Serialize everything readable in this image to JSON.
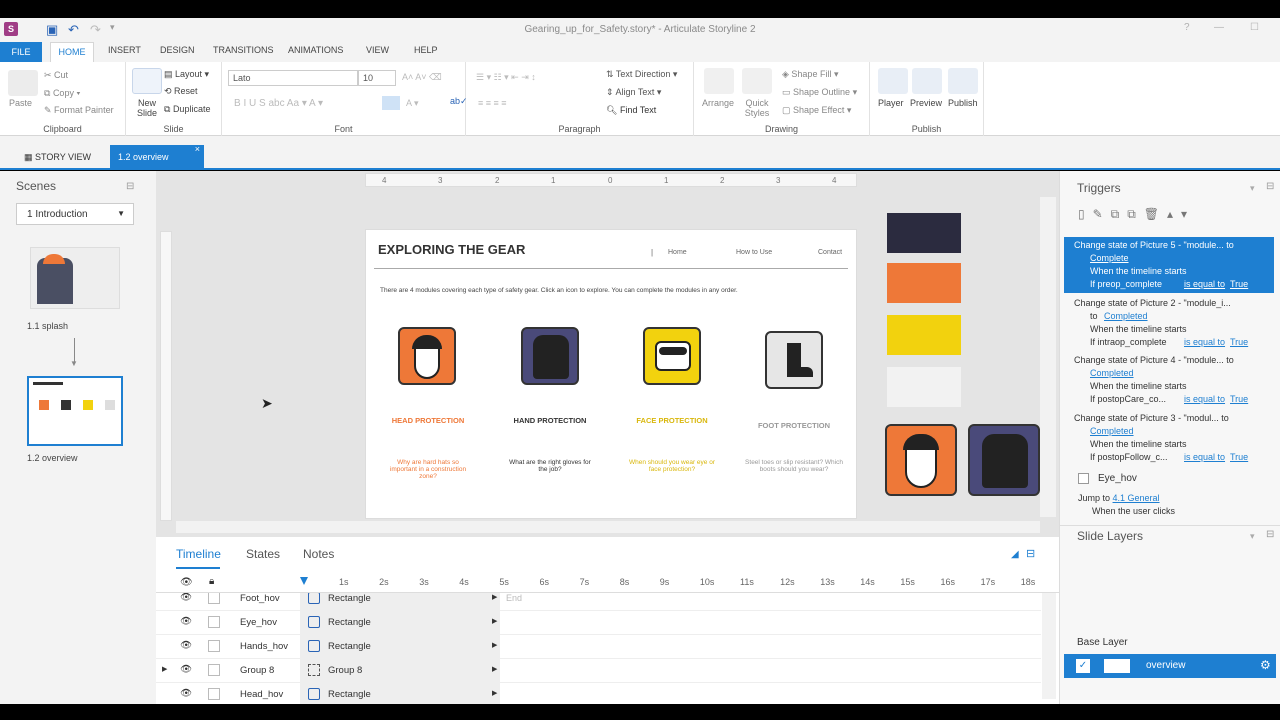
{
  "window": {
    "title": "Gearing_up_for_Safety.story* - Articulate Storyline 2",
    "app_icon": "S"
  },
  "ribbon_tabs": [
    "FILE",
    "HOME",
    "INSERT",
    "DESIGN",
    "TRANSITIONS",
    "ANIMATIONS",
    "VIEW",
    "HELP"
  ],
  "ribbon": {
    "clipboard": {
      "label": "Clipboard",
      "paste": "Paste",
      "cut": "Cut",
      "copy": "Copy",
      "format_painter": "Format Painter"
    },
    "slide": {
      "label": "Slide",
      "new_slide": "New Slide",
      "layout": "Layout",
      "reset": "Reset",
      "duplicate": "Duplicate"
    },
    "font": {
      "label": "Font",
      "font_name": "Lato",
      "font_size": "10"
    },
    "paragraph": {
      "label": "Paragraph",
      "text_direction": "Text Direction",
      "align_text": "Align Text",
      "find_text": "Find Text"
    },
    "drawing": {
      "label": "Drawing",
      "arrange": "Arrange",
      "quick_styles": "Quick Styles",
      "shape_fill": "Shape Fill",
      "shape_outline": "Shape Outline",
      "shape_effect": "Shape Effect"
    },
    "publish": {
      "label": "Publish",
      "player": "Player",
      "preview": "Preview",
      "publish": "Publish"
    }
  },
  "doc_tabs": {
    "story_view": "STORY VIEW",
    "current": "1.2 overview"
  },
  "scenes": {
    "title": "Scenes",
    "selected": "1 Introduction",
    "slides": [
      {
        "label": "1.1 splash"
      },
      {
        "label": "1.2 overview"
      }
    ]
  },
  "ruler": {
    "labels": [
      "4",
      "3",
      "2",
      "1",
      "0",
      "1",
      "2",
      "3",
      "4"
    ]
  },
  "slide": {
    "title": "EXPLORING THE GEAR",
    "nav": [
      "Home",
      "How to Use",
      "Contact"
    ],
    "intro": "There are 4 modules covering each type of safety gear. Click an icon to explore. You can complete the modules in any order.",
    "modules": [
      {
        "name": "HEAD PROTECTION",
        "question": "Why are hard hats so important in a construction zone?",
        "color": "#ee7838",
        "icon": "helmet-icon"
      },
      {
        "name": "HAND PROTECTION",
        "question": "What are the right gloves for the job?",
        "color": "#4a4a7a",
        "icon": "gloves-icon"
      },
      {
        "name": "FACE PROTECTION",
        "question": "When should you wear eye or face protection?",
        "color": "#f2d20e",
        "icon": "goggles-icon"
      },
      {
        "name": "FOOT PROTECTION",
        "question": "Steel toes or slip resistant? Which boots should you wear?",
        "color": "#e6e6e6",
        "icon": "boot-icon"
      }
    ],
    "swatches": [
      "#2b2b3f",
      "#ee7838",
      "#f2d20e",
      "#f2f2f2"
    ]
  },
  "timeline": {
    "tabs": [
      "Timeline",
      "States",
      "Notes"
    ],
    "ticks": [
      "1s",
      "2s",
      "3s",
      "4s",
      "5s",
      "6s",
      "7s",
      "8s",
      "9s",
      "10s",
      "11s",
      "12s",
      "13s",
      "14s",
      "15s",
      "16s",
      "17s",
      "18s"
    ],
    "end_label": "End",
    "rows": [
      {
        "name": "Foot_hov",
        "type": "Rectangle"
      },
      {
        "name": "Eye_hov",
        "type": "Rectangle"
      },
      {
        "name": "Hands_hov",
        "type": "Rectangle"
      },
      {
        "name": "Group 8",
        "type": "Group 8"
      },
      {
        "name": "Head_hov",
        "type": "Rectangle"
      }
    ]
  },
  "triggers": {
    "title": "Triggers",
    "items": [
      {
        "action": "Change state of Picture 5 - \"module... to",
        "state": "Complete",
        "when": "When the timeline starts",
        "cond_var": "If preop_complete",
        "cond_op": "is equal to",
        "cond_val": "True",
        "selected": true
      },
      {
        "action": "Change state of Picture 2 - \"module_i...",
        "state_prefix": "to",
        "state": "Completed",
        "when": "When the timeline starts",
        "cond_var": "If intraop_complete",
        "cond_op": "is equal to",
        "cond_val": "True",
        "selected": false
      },
      {
        "action": "Change state of Picture 4 - \"module... to",
        "state": "Completed",
        "when": "When the timeline starts",
        "cond_var": "If postopCare_co...",
        "cond_op": "is equal to",
        "cond_val": "True",
        "selected": false
      },
      {
        "action": "Change state of Picture 3 - \"modul... to",
        "state": "Completed",
        "when": "When the timeline starts",
        "cond_var": "If postopFollow_c...",
        "cond_op": "is equal to",
        "cond_val": "True",
        "selected": false
      }
    ],
    "eye_hov": {
      "name": "Eye_hov",
      "jump": "Jump to",
      "jump_target": "4.1 General",
      "when": "When the user clicks"
    }
  },
  "slide_layers": {
    "title": "Slide Layers",
    "base_layer": "Base Layer",
    "overview": "overview"
  }
}
